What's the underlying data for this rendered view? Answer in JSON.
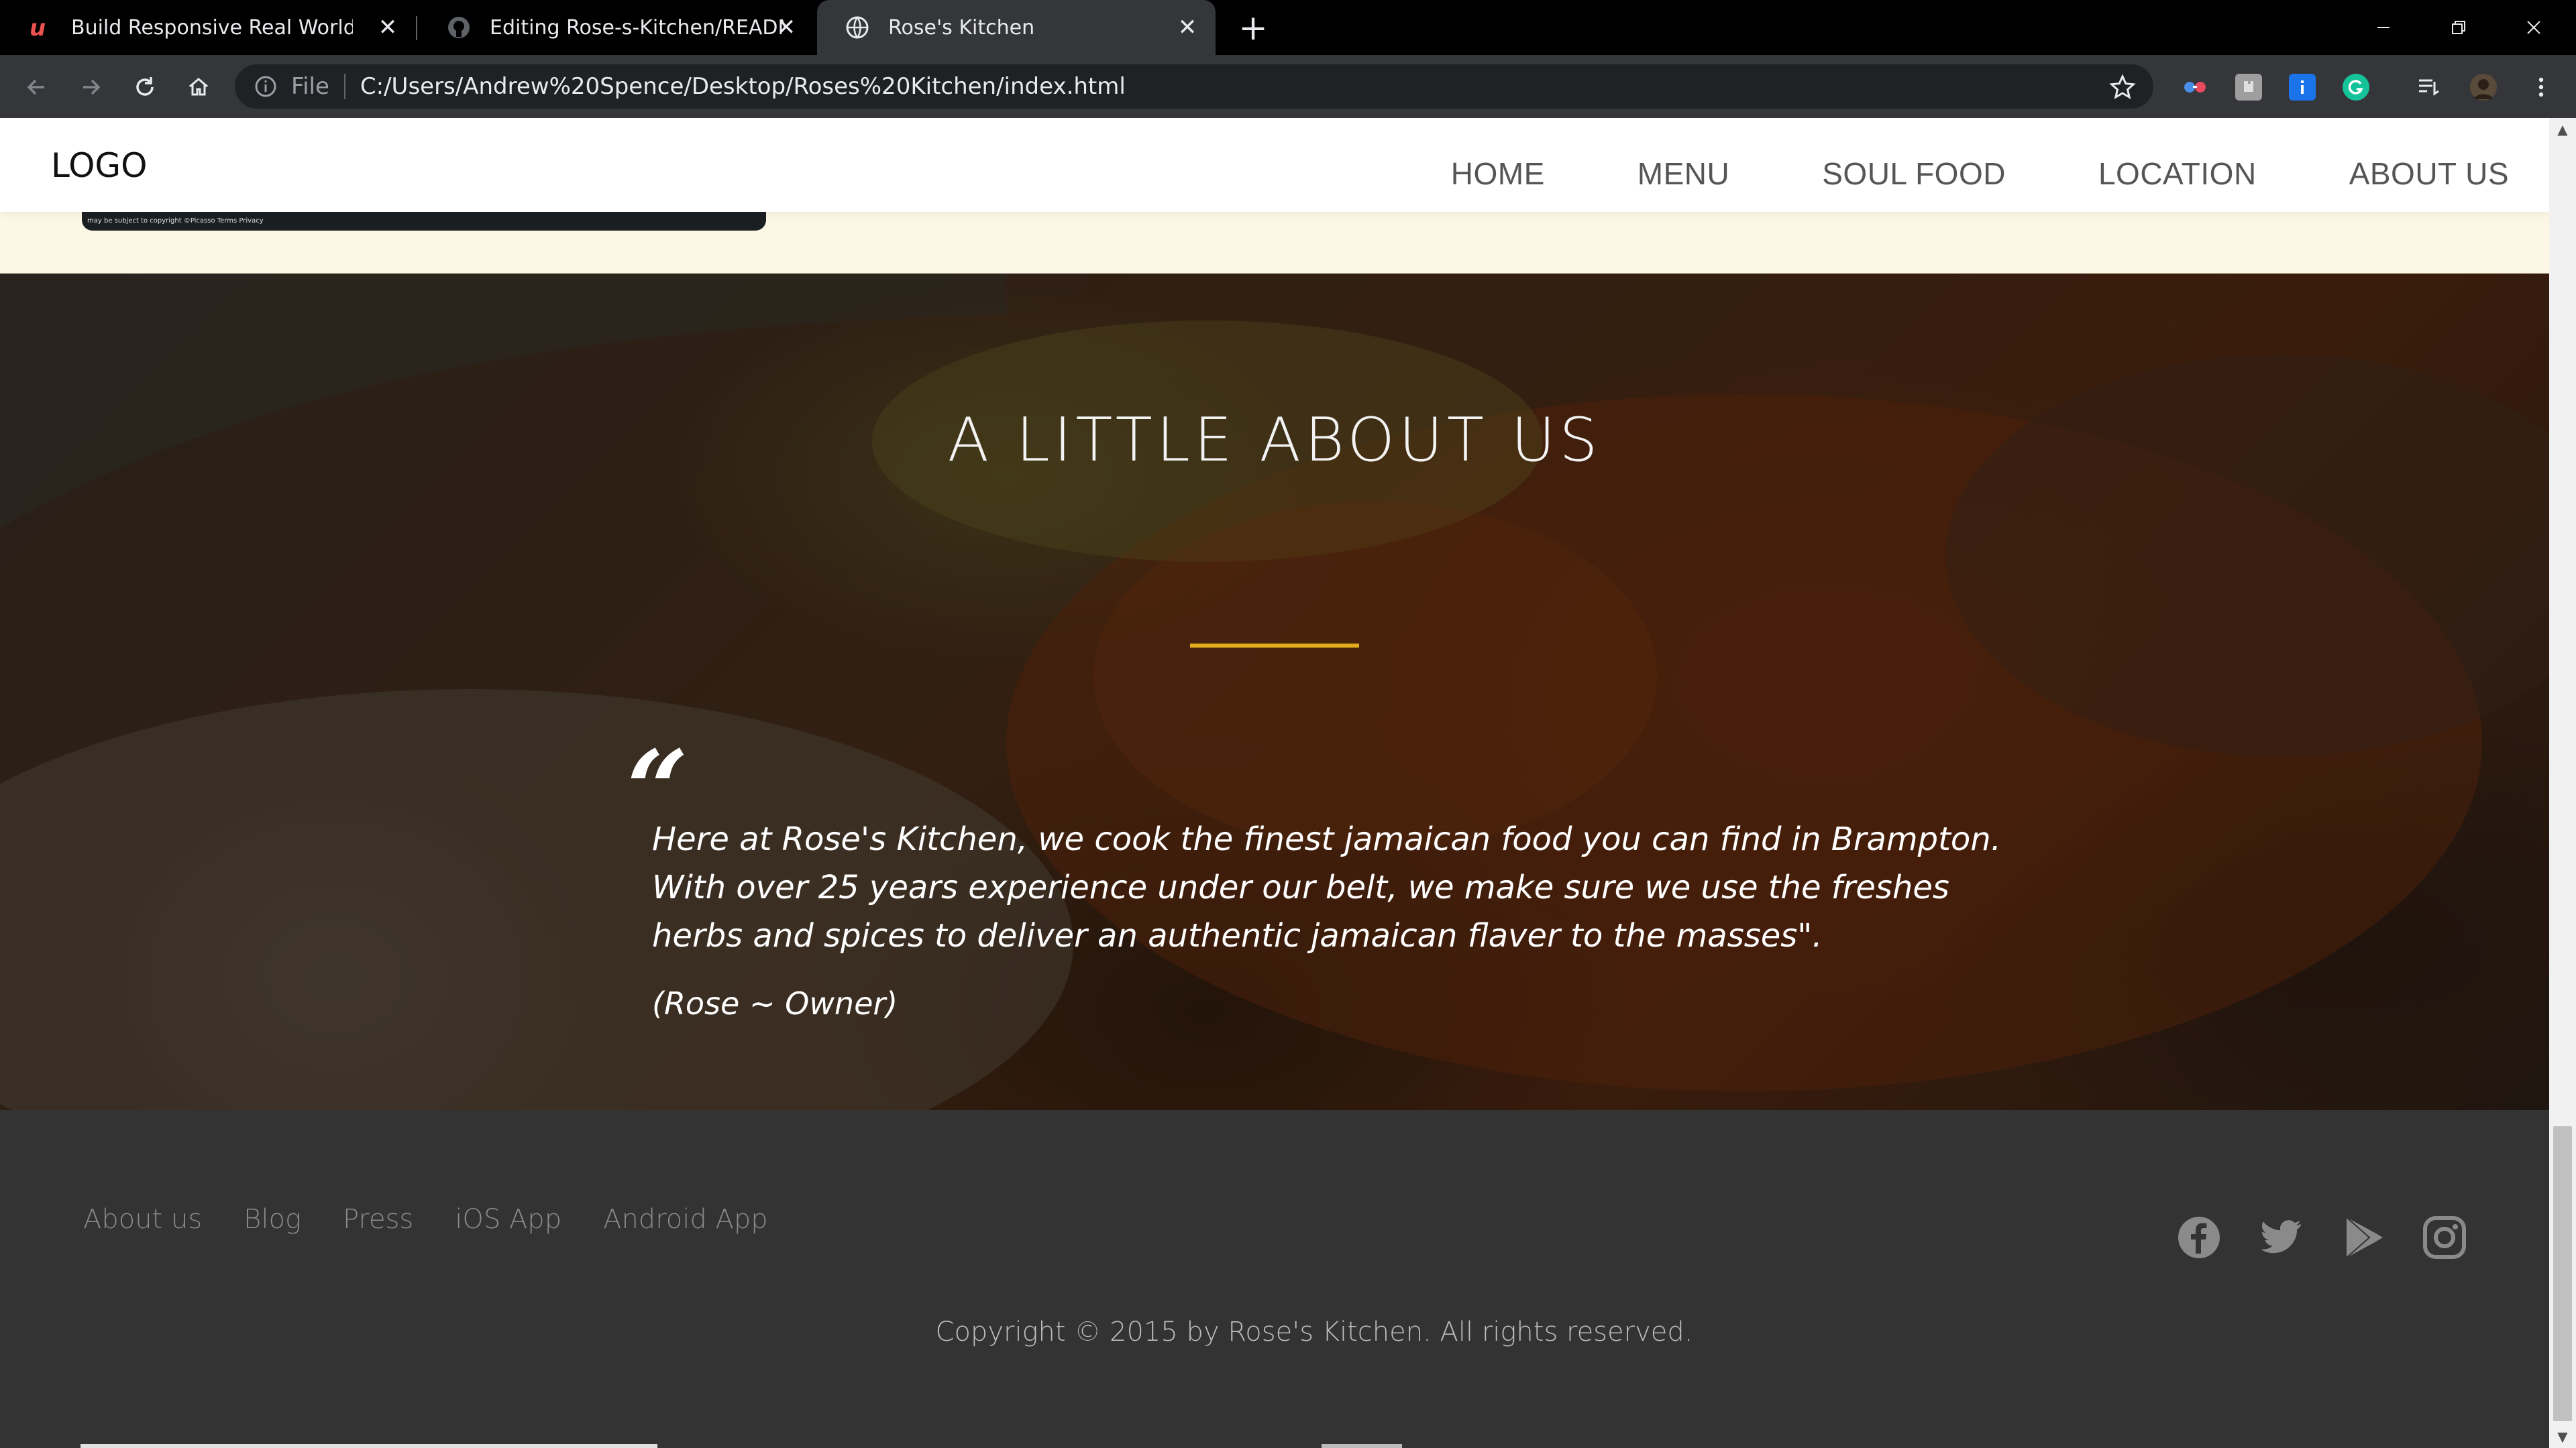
{
  "browser": {
    "tabs": [
      {
        "title": "Build Responsive Real World Web",
        "favicon": "udemy-icon",
        "active": false
      },
      {
        "title": "Editing Rose-s-Kitchen/README.",
        "favicon": "github-icon",
        "active": false
      },
      {
        "title": "Rose's Kitchen",
        "favicon": "globe-icon",
        "active": true
      }
    ],
    "new_tab": "+",
    "scheme_label": "File",
    "url": "C:/Users/Andrew%20Spence/Desktop/Roses%20Kitchen/index.html",
    "colors": {
      "frame": "#000000",
      "toolbar": "#35363a",
      "omnibox": "#202124"
    }
  },
  "site": {
    "logo": "LOGO",
    "nav": [
      "HOME",
      "MENU",
      "SOUL FOOD",
      "LOCATION",
      "ABOUT US"
    ],
    "map_fine_print": "may be subject to copyright  ©Picasso   Terms   Privacy",
    "about": {
      "title": "A LITTLE ABOUT US",
      "quote_mark": "“",
      "quote": "Here at Rose's Kitchen, we cook the finest jamaican food you can find in Brampton. With over 25 years experience under our belt, we make sure we use the freshes herbs and spices to deliver an authentic jamaican flaver to the masses\".",
      "author": "(Rose ~ Owner)",
      "accent_color": "#e2ac1c"
    },
    "footer": {
      "links": [
        "About us",
        "Blog",
        "Press",
        "iOS App",
        "Android App"
      ],
      "social_icons": [
        "facebook-icon",
        "twitter-icon",
        "google-play-icon",
        "instagram-icon"
      ],
      "copyright": "Copyright © 2015 by Rose's Kitchen. All rights reserved."
    }
  }
}
